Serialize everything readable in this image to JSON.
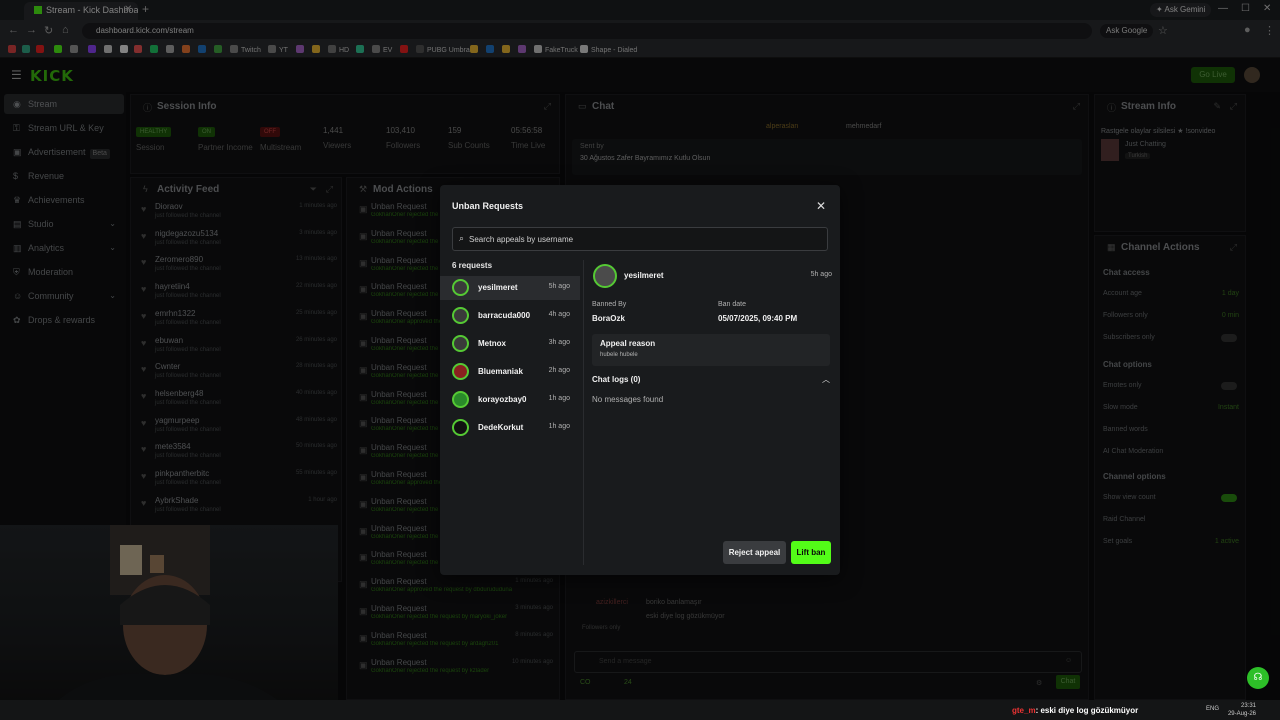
{
  "browser": {
    "tab_title": "Stream - Kick Dashboard",
    "url": "dashboard.kick.com/stream",
    "ask_gemini": "Ask Gemini",
    "ask_google": "Ask Google",
    "bookmarks": [
      "Twitch",
      "YT",
      "HD",
      "EV",
      "PUBG Umbra",
      "FakeTruck",
      "Shape - Dialed"
    ]
  },
  "app": {
    "logo": "KICK",
    "go_live": "Go Live"
  },
  "sidebar": {
    "items": [
      {
        "label": "Stream",
        "icon": "broadcast-icon"
      },
      {
        "label": "Stream URL & Key",
        "icon": "key-icon"
      },
      {
        "label": "Advertisement",
        "icon": "ad-icon",
        "badge": "Beta"
      },
      {
        "label": "Revenue",
        "icon": "dollar-icon"
      },
      {
        "label": "Achievements",
        "icon": "trophy-icon"
      },
      {
        "label": "Studio",
        "icon": "studio-icon"
      },
      {
        "label": "Analytics",
        "icon": "chart-icon"
      },
      {
        "label": "Moderation",
        "icon": "shield-icon"
      },
      {
        "label": "Community",
        "icon": "users-icon"
      },
      {
        "label": "Drops & rewards",
        "icon": "gift-icon"
      }
    ]
  },
  "session": {
    "title": "Session Info",
    "stats": [
      {
        "value": "HEALTHY",
        "label": "Session"
      },
      {
        "value": "ON",
        "label": "Partner Income"
      },
      {
        "value": "OFF",
        "label": "Multistream"
      },
      {
        "value": "1,441",
        "label": "Viewers"
      },
      {
        "value": "103,410",
        "label": "Followers"
      },
      {
        "value": "159",
        "label": "Sub Counts"
      },
      {
        "value": "05:56:58",
        "label": "Time Live"
      }
    ]
  },
  "activity_feed": {
    "title": "Activity Feed",
    "subtitle": "just followed the channel",
    "rows": [
      {
        "user": "Dioraov",
        "time": "1 minutes ago"
      },
      {
        "user": "nigdegazozu5134",
        "time": "3 minutes ago"
      },
      {
        "user": "Zeromero890",
        "time": "13 minutes ago"
      },
      {
        "user": "hayretiin4",
        "time": "22 minutes ago"
      },
      {
        "user": "emrhn1322",
        "time": "25 minutes ago"
      },
      {
        "user": "ebuwan",
        "time": "26 minutes ago"
      },
      {
        "user": "Cwnter",
        "time": "28 minutes ago"
      },
      {
        "user": "helsenberg48",
        "time": "40 minutes ago"
      },
      {
        "user": "yagmurpeep",
        "time": "48 minutes ago"
      },
      {
        "user": "mete3584",
        "time": "50 minutes ago"
      },
      {
        "user": "pinkpantherbitc",
        "time": "55 minutes ago"
      },
      {
        "user": "AybrkShade",
        "time": "1 hour ago"
      }
    ]
  },
  "mod_actions": {
    "title": "Mod Actions",
    "rows": [
      {
        "action": "Unban Request",
        "detail": "GokhanOner rejected the request by",
        "time": ""
      },
      {
        "action": "Unban Request",
        "detail": "GokhanOner rejected the",
        "time": ""
      },
      {
        "action": "Unban Request",
        "detail": "GokhanOner rejected the",
        "time": ""
      },
      {
        "action": "Unban Request",
        "detail": "GokhanOner rejected the",
        "time": ""
      },
      {
        "action": "Unban Request",
        "detail": "GokhanOner approved the",
        "time": ""
      },
      {
        "action": "Unban Request",
        "detail": "GokhanOner rejected the",
        "time": ""
      },
      {
        "action": "Unban Request",
        "detail": "GokhanOner rejected the",
        "time": ""
      },
      {
        "action": "Unban Request",
        "detail": "GokhanOner rejected the",
        "time": ""
      },
      {
        "action": "Unban Request",
        "detail": "GokhanOner rejected the",
        "time": ""
      },
      {
        "action": "Unban Request",
        "detail": "GokhanOner rejected the",
        "time": ""
      },
      {
        "action": "Unban Request",
        "detail": "GokhanOner approved the",
        "time": ""
      },
      {
        "action": "Unban Request",
        "detail": "GokhanOner rejected the",
        "time": ""
      },
      {
        "action": "Unban Request",
        "detail": "GokhanOner rejected the",
        "time": ""
      },
      {
        "action": "Unban Request",
        "detail": "GokhanOner rejected the request by reddemayimdoride",
        "time": ""
      },
      {
        "action": "Unban Request",
        "detail": "GokhanOner approved the request by dbdurududuna",
        "time": "1 minutes ago"
      },
      {
        "action": "Unban Request",
        "detail": "GokhanOner rejected the request by maryoki_joker",
        "time": "3 minutes ago"
      },
      {
        "action": "Unban Request",
        "detail": "GokhanOner rejected the request by ardagh201",
        "time": "8 minutes ago"
      },
      {
        "action": "Unban Request",
        "detail": "GokhanOner rejected the request by kzlader",
        "time": "10 minutes ago"
      }
    ]
  },
  "chat": {
    "title": "Chat",
    "pinned_users": [
      "alperaslan",
      "mehmedarf"
    ],
    "sent_by": "Sent by",
    "pinned_message": "30 Ağustos Zafer Bayramımız Kutlu Olsun",
    "lines": [
      {
        "user": "azizkillerci",
        "text": "boriko banlamaşır"
      },
      {
        "user": "",
        "text": "eski diye log gözükmüyor"
      }
    ],
    "followers_only": "Followers only",
    "input_placeholder": "Send a message",
    "stat_a": "CO",
    "stat_b": "24",
    "send_label": "Chat"
  },
  "stream_info": {
    "title": "Stream Info",
    "stream_title": "Rastgele olaylar silsilesi ★ !sonvideo",
    "category": "Just Chatting",
    "language": "Turkish"
  },
  "channel_actions": {
    "title": "Channel Actions",
    "sections": [
      {
        "heading": "Chat access",
        "rows": [
          {
            "label": "Account age",
            "value": "1 day"
          },
          {
            "label": "Followers only",
            "value": "0 min"
          },
          {
            "label": "Subscribers only",
            "value": ""
          }
        ]
      },
      {
        "heading": "Chat options",
        "rows": [
          {
            "label": "Emotes only",
            "value": ""
          },
          {
            "label": "Slow mode",
            "value": "Instant"
          },
          {
            "label": "Banned words",
            "value": ""
          },
          {
            "label": "AI Chat Moderation",
            "value": ""
          }
        ]
      },
      {
        "heading": "Channel options",
        "rows": [
          {
            "label": "Show view count",
            "value": ""
          },
          {
            "label": "Raid Channel",
            "value": ""
          },
          {
            "label": "Set goals",
            "value": "1 active"
          }
        ]
      }
    ]
  },
  "modal": {
    "title": "Unban Requests",
    "search_placeholder": "Search appeals by username",
    "count_label": "6 requests",
    "requests": [
      {
        "name": "yesilmeret",
        "time": "5h ago"
      },
      {
        "name": "barracuda000",
        "time": "4h ago"
      },
      {
        "name": "Metnox",
        "time": "3h ago"
      },
      {
        "name": "Bluemaniak",
        "time": "2h ago"
      },
      {
        "name": "korayozbay0",
        "time": "1h ago"
      },
      {
        "name": "DedeKorkut",
        "time": "1h ago"
      }
    ],
    "detail": {
      "name": "yesilmeret",
      "time": "5h ago",
      "banned_by_label": "Banned By",
      "banned_by": "BoraOzk",
      "ban_date_label": "Ban date",
      "ban_date": "05/07/2025, 09:40 PM",
      "appeal_reason_label": "Appeal reason",
      "appeal_reason": "hubele hubele",
      "chat_logs_label": "Chat logs (0)",
      "no_messages": "No messages found"
    },
    "reject_label": "Reject appeal",
    "lift_label": "Lift ban"
  },
  "taskbar": {
    "chat_user": "gte_m",
    "chat_text": ": eski diye log gözükmüyor",
    "lang": "ENG",
    "time": "23:31",
    "date": "29-Aug-26"
  }
}
